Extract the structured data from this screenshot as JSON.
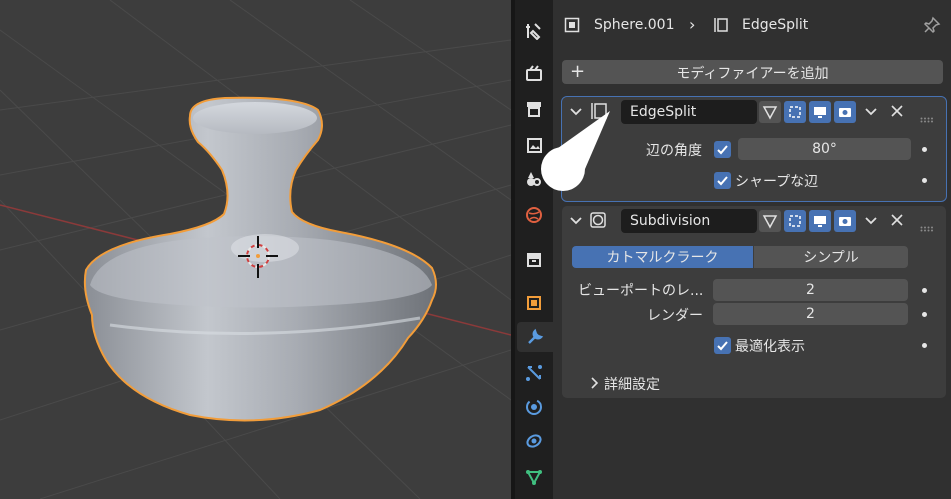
{
  "header": {
    "object_name": "Sphere.001",
    "modifier_name": "EdgeSplit"
  },
  "add_modifier_label": "モディファイアーを追加",
  "modifiers": [
    {
      "name": "EdgeSplit",
      "edge_angle_label": "辺の角度",
      "edge_angle_value": "80°",
      "sharp_edges_label": "シャープな辺"
    },
    {
      "name": "Subdivision",
      "tabs": [
        "カトマルクラーク",
        "シンプル"
      ],
      "viewport_label": "ビューポートのレ...",
      "viewport_value": "2",
      "render_label": "レンダー",
      "render_value": "2",
      "optimal_display_label": "最適化表示",
      "advanced_label": "詳細設定"
    }
  ],
  "colors": {
    "accent": "#4772b3",
    "selection_outline": "#f29d3a",
    "panel": "#3d3d3d",
    "background": "#303030"
  },
  "sidebar_tabs": [
    "tool-icon",
    "render-icon",
    "output-icon",
    "view-layer-icon",
    "scene-icon",
    "world-icon",
    "collection-icon",
    "object-icon",
    "modifier-icon",
    "particles-icon",
    "physics-icon",
    "constraints-icon",
    "data-icon"
  ]
}
